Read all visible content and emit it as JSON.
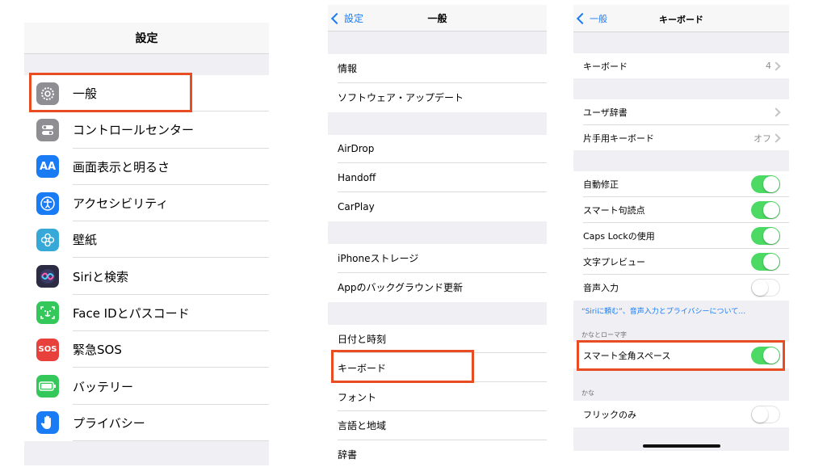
{
  "colors": {
    "accent": "#1a7cf5",
    "toggle_on": "#4cd964",
    "highlight": "#e84c22",
    "group_bg": "#efeff4"
  },
  "panel1": {
    "title": "設定",
    "items": [
      {
        "label": "一般",
        "icon": "gear-icon",
        "color": "#8e8e93"
      },
      {
        "label": "コントロールセンター",
        "icon": "control-center-icon",
        "color": "#8e8e93"
      },
      {
        "label": "画面表示と明るさ",
        "icon": "display-icon",
        "color": "#1a7cf5",
        "glyph": "AA"
      },
      {
        "label": "アクセシビリティ",
        "icon": "accessibility-icon",
        "color": "#1a7cf5"
      },
      {
        "label": "壁紙",
        "icon": "wallpaper-icon",
        "color": "#36a9d8"
      },
      {
        "label": "Siriと検索",
        "icon": "siri-icon",
        "color": "#2b2b44"
      },
      {
        "label": "Face IDとパスコード",
        "icon": "face-id-icon",
        "color": "#34c759"
      },
      {
        "label": "緊急SOS",
        "icon": "sos-icon",
        "color": "#e8403a",
        "glyph": "SOS"
      },
      {
        "label": "バッテリー",
        "icon": "battery-icon",
        "color": "#34c759"
      },
      {
        "label": "プライバシー",
        "icon": "privacy-hand-icon",
        "color": "#1a7cf5"
      }
    ]
  },
  "panel2": {
    "back": "設定",
    "title": "一般",
    "groups": [
      [
        "情報",
        "ソフトウェア・アップデート"
      ],
      [
        "AirDrop",
        "Handoff",
        "CarPlay"
      ],
      [
        "iPhoneストレージ",
        "Appのバックグラウンド更新"
      ],
      [
        "日付と時刻",
        "キーボード",
        "フォント",
        "言語と地域",
        "辞書"
      ]
    ]
  },
  "panel3": {
    "back": "一般",
    "title": "キーボード",
    "keyboards": {
      "label": "キーボード",
      "value": "4"
    },
    "user_dict": {
      "label": "ユーザ辞書"
    },
    "one_hand": {
      "label": "片手用キーボード",
      "value": "オフ"
    },
    "toggles": [
      {
        "label": "自動修正",
        "on": true
      },
      {
        "label": "スマート句読点",
        "on": true
      },
      {
        "label": "Caps Lockの使用",
        "on": true
      },
      {
        "label": "文字プレビュー",
        "on": true
      },
      {
        "label": "音声入力",
        "on": false
      }
    ],
    "siri_note": "“Siriに頼む”、音声入力とプライバシーについて…",
    "kana_romaji_header": "かなとローマ字",
    "smart_space": {
      "label": "スマート全角スペース",
      "on": true
    },
    "kana_header": "かな",
    "flick_only": {
      "label": "フリックのみ",
      "on": false
    }
  }
}
